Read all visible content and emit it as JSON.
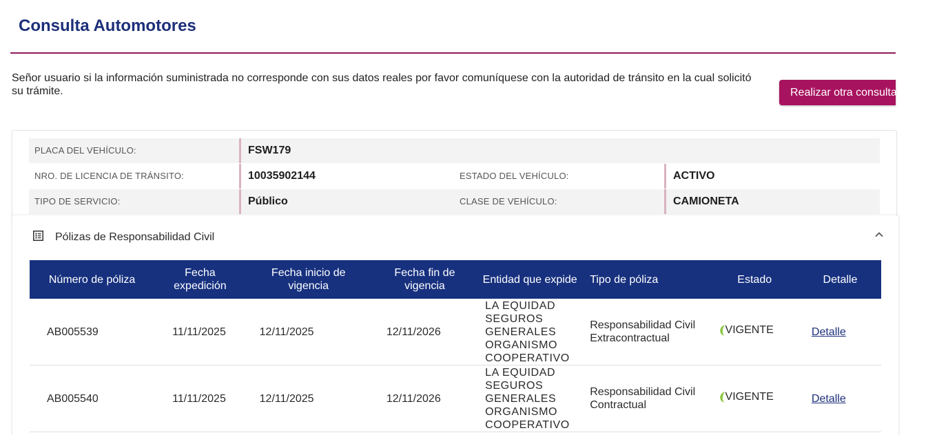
{
  "header": {
    "title": "Consulta Automotores"
  },
  "notice": {
    "text": "Señor usuario si la información suministrada no corresponde con sus datos reales por favor comuníquese con la autoridad de tránsito en la cual solicitó su trámite."
  },
  "actions": {
    "new_query_label": "Realizar otra consulta"
  },
  "vehicle": {
    "plate_label": "PLACA DEL VEHÍCULO:",
    "plate_value": "FSW179",
    "license_label": "NRO. DE LICENCIA DE TRÁNSITO:",
    "license_value": "10035902144",
    "status_label": "ESTADO DEL VEHÍCULO:",
    "status_value": "ACTIVO",
    "service_label": "TIPO DE SERVICIO:",
    "service_value": "Público",
    "class_label": "CLASE DE VEHÍCULO:",
    "class_value": "CAMIONETA"
  },
  "policies": {
    "section_title": "Pólizas de Responsabilidad Civil",
    "icons": {
      "section": "list-icon",
      "toggle": "chevron-up-icon",
      "status": "leaf-icon"
    },
    "colors": {
      "header_bg": "#17317f",
      "accent": "#a8135f",
      "status_ok": "#8cc63f"
    },
    "columns": [
      "Número de póliza",
      "Fecha expedición",
      "Fecha inicio de vigencia",
      "Fecha fin de vigencia",
      "Entidad que expide",
      "Tipo de póliza",
      "Estado",
      "Detalle"
    ],
    "rows": [
      {
        "numero": "AB005539",
        "expedicion": "11/11/2025",
        "inicio": "12/11/2025",
        "fin": "12/11/2026",
        "entidad": "LA EQUIDAD SEGUROS GENERALES ORGANISMO COOPERATIVO",
        "tipo": "Responsabilidad Civil Extracontractual",
        "estado": "VIGENTE",
        "detalle": "Detalle"
      },
      {
        "numero": "AB005540",
        "expedicion": "11/11/2025",
        "inicio": "12/11/2025",
        "fin": "12/11/2026",
        "entidad": "LA EQUIDAD SEGUROS GENERALES ORGANISMO COOPERATIVO",
        "tipo": "Responsabilidad Civil Contractual",
        "estado": "VIGENTE",
        "detalle": "Detalle"
      }
    ]
  }
}
